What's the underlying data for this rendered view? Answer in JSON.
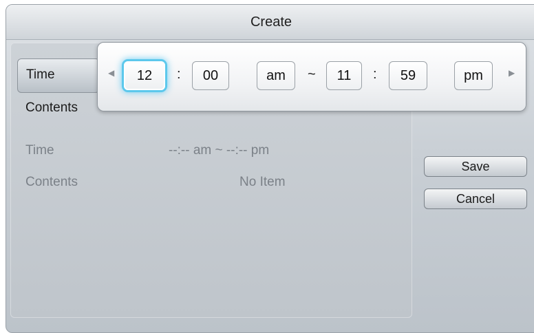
{
  "dialog": {
    "title": "Create"
  },
  "tabs": {
    "time": "Time",
    "contents": "Contents"
  },
  "info": {
    "time_label": "Time",
    "time_value": "--:-- am ~ --:-- pm",
    "contents_label": "Contents",
    "contents_value": "No Item"
  },
  "buttons": {
    "save": "Save",
    "cancel": "Cancel"
  },
  "picker": {
    "start_hour": "12",
    "start_minute": "00",
    "start_ampm": "am",
    "range_sep": "~",
    "time_sep": ":",
    "end_hour": "11",
    "end_minute": "59",
    "end_ampm": "pm",
    "left_arrow": "◀",
    "right_arrow": "▶"
  },
  "colors": {
    "focus": "#5cc8ec",
    "muted_text": "#7b8188"
  }
}
